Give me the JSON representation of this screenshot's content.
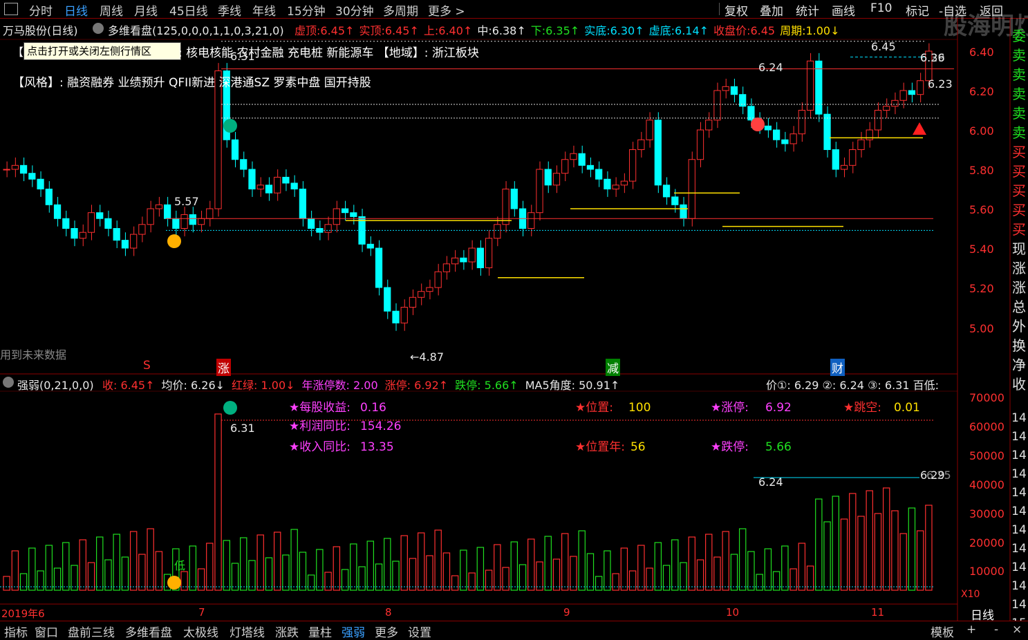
{
  "watermark": "股海明灯",
  "topmenu": {
    "items": [
      "分时",
      "日线",
      "周线",
      "月线",
      "45日线",
      "季线",
      "年线",
      "15分钟",
      "30分钟",
      "多周期",
      "更多"
    ],
    "active": "日线",
    "right": [
      "复权",
      "叠加",
      "统计",
      "画线",
      "F10",
      "标记",
      "-自选",
      "返回"
    ]
  },
  "stock": {
    "name": "万马股份(日线)",
    "indicator": "多维看盘(125,0,0,0,1,1,0,3,21,0)",
    "params": [
      {
        "label": "虚顶:",
        "value": "6.45",
        "arrow": "↑",
        "color": "red"
      },
      {
        "label": "实顶:",
        "value": "6.45",
        "arrow": "↑",
        "color": "red"
      },
      {
        "label": "上:",
        "value": "6.40",
        "arrow": "↑",
        "color": "red"
      },
      {
        "label": "中:",
        "value": "6.38",
        "arrow": "↑",
        "color": "white"
      },
      {
        "label": "下:",
        "value": "6.35",
        "arrow": "↑",
        "color": "green"
      },
      {
        "label": "实底:",
        "value": "6.30",
        "arrow": "↑",
        "color": "cyan"
      },
      {
        "label": "虚底:",
        "value": "6.14",
        "arrow": "↑",
        "color": "cyan"
      },
      {
        "label": "收盘价:",
        "value": "6.45",
        "arrow": "",
        "color": "red"
      },
      {
        "label": "周期:",
        "value": "1.00",
        "arrow": "↓",
        "color": "yellow"
      }
    ]
  },
  "tooltip": "点击打开或关闭左侧行情区",
  "concept_line": "核电核能 农村金融 充电桩 新能源车 【地域】: 浙江板块",
  "style_line": "【风格】: 融资融券 业绩预升 QFII新进 深港通SZ 罗素中盘 国开持股",
  "future_note": "用到未来数据",
  "price_axis": [
    "6.40",
    "6.20",
    "6.00",
    "5.80",
    "5.60",
    "5.40",
    "5.20",
    "5.00"
  ],
  "price_labels": {
    "hi1": "6.31",
    "hi2": "6.24",
    "hi3": "6.45",
    "hi4": "6.36",
    "hi5": "6.23",
    "hi6": "6.29",
    "lo1": "5.57",
    "lo2": "4.87"
  },
  "event_markers": [
    {
      "text": "S",
      "color": "red"
    },
    {
      "text": "涨",
      "color": "red"
    },
    {
      "text": "减",
      "color": "green"
    },
    {
      "text": "财",
      "color": "cyan"
    }
  ],
  "sub_indicator": {
    "name": "强弱(0,21,0,0)",
    "fields": [
      {
        "label": "收:",
        "value": "6.45",
        "arrow": "↑",
        "color": "red"
      },
      {
        "label": "均价:",
        "value": "6.26",
        "arrow": "↓",
        "color": "white"
      },
      {
        "label": "红绿:",
        "value": "1.00",
        "arrow": "↓",
        "color": "red"
      },
      {
        "label": "年涨停数:",
        "value": "2.00",
        "arrow": "",
        "color": "magenta"
      },
      {
        "label": "涨停:",
        "value": "6.92",
        "arrow": "↑",
        "color": "red"
      },
      {
        "label": "跌停:",
        "value": "5.66",
        "arrow": "↑",
        "color": "green"
      },
      {
        "label": "MA5角度:",
        "value": "50.91",
        "arrow": "↑",
        "color": "white"
      }
    ],
    "right_info": "价①: 6.29 ②: 6.24 ③: 6.31 百低:"
  },
  "fundamentals": [
    {
      "label": "每股收益:",
      "value": "0.16"
    },
    {
      "label": "利润同比:",
      "value": "154.26"
    },
    {
      "label": "收入同比:",
      "value": "13.35"
    },
    {
      "label": "位置:",
      "value": "100"
    },
    {
      "label": "位置年:",
      "value": "56"
    },
    {
      "label": "涨停:",
      "value": "6.92"
    },
    {
      "label": "跌停:",
      "value": "5.66"
    },
    {
      "label": "跳空:",
      "value": "0.01"
    }
  ],
  "volume_axis": [
    "70000",
    "60000",
    "50000",
    "40000",
    "30000",
    "20000",
    "10000",
    "X10"
  ],
  "volume_labels": {
    "v1": "6.31",
    "v2": "6.24",
    "v3": "6.29",
    "v4": "6.25",
    "low": "低"
  },
  "time_axis": [
    "2019年6",
    "7",
    "8",
    "9",
    "10",
    "11"
  ],
  "period_label": "日线",
  "right_column": [
    "委",
    "卖",
    "卖",
    "卖",
    "卖",
    "卖",
    "买",
    "买",
    "买",
    "买",
    "买",
    "现",
    "涨",
    "涨",
    "总",
    "外",
    "换",
    "净",
    "收"
  ],
  "right_col_nums": [
    "14",
    "14",
    "14",
    "14",
    "14",
    "14",
    "14",
    "14",
    "14",
    "14",
    "14",
    "15"
  ],
  "bottom_tabs": [
    "指标",
    "窗口",
    "盘前三线",
    "多维看盘",
    "太极线",
    "灯塔线",
    "涨跌",
    "量柱",
    "强弱",
    "更多",
    "设置"
  ],
  "bottom_active": "强弱",
  "bottom_right": [
    "模板",
    "+",
    "-",
    "×"
  ],
  "colors": {
    "up": "#ff3030",
    "down": "#00ffff",
    "hollowred": "#ff3030",
    "yellow": "#ffe000",
    "accent": "#3aa0ff"
  }
}
